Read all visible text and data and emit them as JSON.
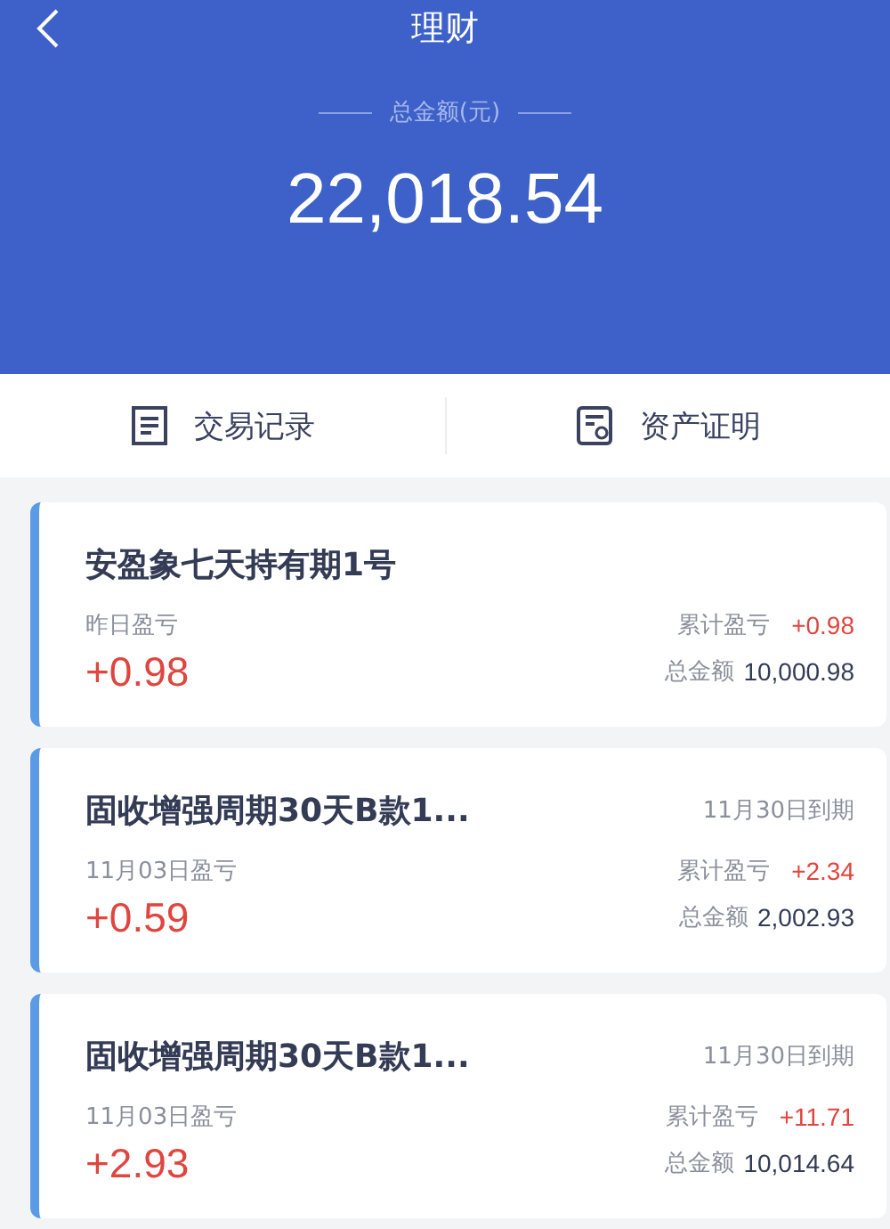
{
  "header": {
    "title": "理财",
    "total_label": "总金额(元)",
    "total": "22,018.54"
  },
  "actions": [
    {
      "label": "交易记录",
      "kind": "records"
    },
    {
      "label": "资产证明",
      "kind": "certificate"
    }
  ],
  "products": [
    {
      "name": "安盈象七天持有期1号",
      "daily_label": "昨日盈亏",
      "daily": "+0.98",
      "cumulative_label": "累计盈亏",
      "cumulative": "+0.98",
      "amount_label": "总金额",
      "amount": "10,000.98"
    },
    {
      "name": "固收增强周期30天B款1...",
      "maturity": "11月30日到期",
      "daily_label": "11月03日盈亏",
      "daily": "+0.59",
      "cumulative_label": "累计盈亏",
      "cumulative": "+2.34",
      "amount_label": "总金额",
      "amount": "2,002.93"
    },
    {
      "name": "固收增强周期30天B款1...",
      "maturity": "11月30日到期",
      "daily_label": "11月03日盈亏",
      "daily": "+2.93",
      "cumulative_label": "累计盈亏",
      "cumulative": "+11.71",
      "amount_label": "总金额",
      "amount": "10,014.64"
    }
  ]
}
